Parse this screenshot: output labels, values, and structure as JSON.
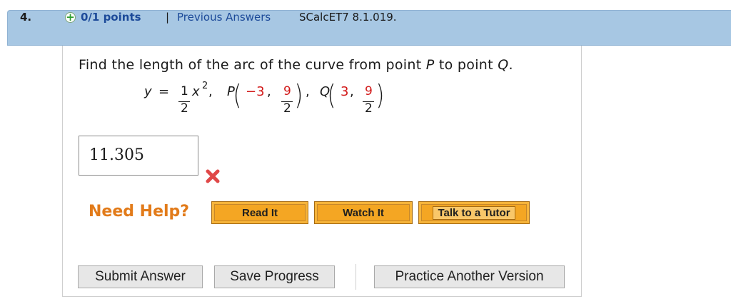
{
  "header": {
    "question_number": "4.",
    "points": "0/1 points",
    "separator": "|",
    "previous_answers_link": "Previous Answers",
    "source": "SCalcET7 8.1.019."
  },
  "question": {
    "prefix": "Find the length of the arc of the curve from point ",
    "p": "P",
    "middle": " to point ",
    "q": "Q",
    "end": "."
  },
  "equation": {
    "y": "y",
    "equals": "=",
    "coef_num": "1",
    "coef_den": "2",
    "x_term": "x",
    "exponent": "2",
    "comma1": ",",
    "P_label": "P",
    "P_x": "−3",
    "P_y_num": "9",
    "P_y_den": "2",
    "comma2": ",",
    "Q_label": "Q",
    "Q_x": "3",
    "Q_y_num": "9",
    "Q_y_den": "2",
    "open_paren": "(",
    "close_paren": ")",
    "inner_comma": ","
  },
  "answer": {
    "value": "11.305",
    "status": "incorrect",
    "status_color": "#e04848"
  },
  "help": {
    "label": "Need Help?",
    "buttons": [
      "Read It",
      "Watch It",
      "Talk to a Tutor"
    ]
  },
  "actions": {
    "submit": "Submit Answer",
    "save": "Save Progress",
    "practice": "Practice Another Version"
  }
}
